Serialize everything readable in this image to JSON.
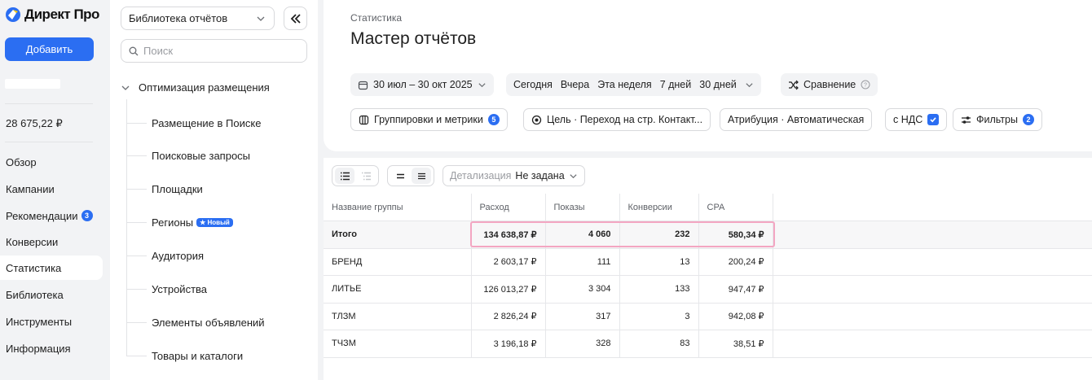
{
  "app": {
    "logo_text": "Директ Про",
    "add_label": "Добавить",
    "balance": "28 675,22 ₽"
  },
  "nav": [
    {
      "label": "Обзор"
    },
    {
      "label": "Кампании"
    },
    {
      "label": "Рекомендации",
      "badge": "3"
    },
    {
      "label": "Конверсии"
    },
    {
      "label": "Статистика",
      "active": true
    },
    {
      "label": "Библиотека"
    },
    {
      "label": "Инструменты"
    },
    {
      "label": "Информация"
    }
  ],
  "library": {
    "select_value": "Библиотека отчётов",
    "search_placeholder": "Поиск",
    "root": "Оптимизация размещения",
    "items": [
      {
        "label": "Размещение в Поиске"
      },
      {
        "label": "Поисковые запросы"
      },
      {
        "label": "Площадки"
      },
      {
        "label": "Регионы",
        "badge": "★ Новый"
      },
      {
        "label": "Аудитория"
      },
      {
        "label": "Устройства"
      },
      {
        "label": "Элементы объявлений"
      },
      {
        "label": "Товары и каталоги"
      }
    ]
  },
  "header": {
    "breadcrumb": "Статистика",
    "title": "Мастер отчётов",
    "date_range": "30 июл – 30 окт 2025",
    "periods": [
      "Сегодня",
      "Вчера",
      "Эта неделя",
      "7 дней",
      "30 дней"
    ],
    "compare": "Сравнение",
    "groupings": "Группировки и метрики",
    "groupings_count": "5",
    "goal": "Цель · Переход на стр. Контакт...",
    "attribution": "Атрибуция · Автоматическая",
    "vat": "с НДС",
    "filters": "Фильтры",
    "filters_count": "2"
  },
  "toolbar": {
    "detail_label": "Детализация",
    "detail_value": "Не задана"
  },
  "table": {
    "columns": [
      "Название группы",
      "Расход",
      "Показы",
      "Конверсии",
      "CPA"
    ],
    "rows": [
      [
        "Итого",
        "134 638,87 ₽",
        "4 060",
        "232",
        "580,34 ₽"
      ],
      [
        "БРЕНД",
        "2 603,17 ₽",
        "111",
        "13",
        "200,24 ₽"
      ],
      [
        "ЛИТЬЕ",
        "126 013,27 ₽",
        "3 304",
        "133",
        "947,47 ₽"
      ],
      [
        "ТЛЗМ",
        "2 826,24 ₽",
        "317",
        "3",
        "942,08 ₽"
      ],
      [
        "ТЧЗМ",
        "3 196,18 ₽",
        "328",
        "83",
        "38,51 ₽"
      ]
    ]
  },
  "colors": {
    "accent": "#2b6ef2",
    "highlight": "#f3a6c2"
  }
}
